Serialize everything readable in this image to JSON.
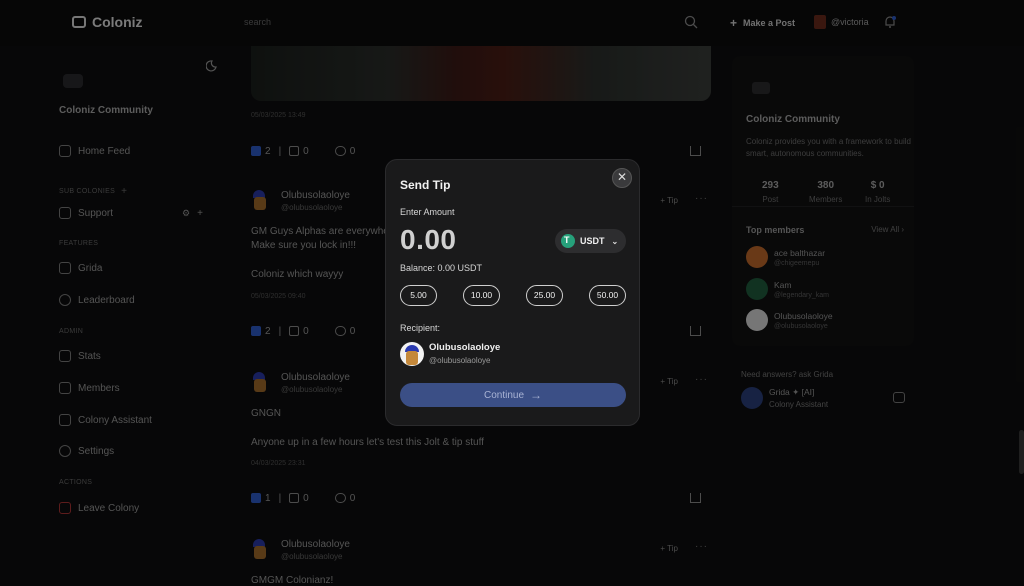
{
  "topbar": {
    "logo": "Coloniz",
    "search_placeholder": "search",
    "make_post": "Make a Post",
    "user": "@victoria"
  },
  "sidebar": {
    "community_name": "Coloniz Community",
    "home_feed": "Home Feed",
    "sub_colonies_label": "SUB COLONIES",
    "support": "Support",
    "features_label": "FEATURES",
    "grida": "Grida",
    "leaderboard": "Leaderboard",
    "admin_label": "ADMIN",
    "stats": "Stats",
    "members": "Members",
    "colony_assistant": "Colony Assistant",
    "settings": "Settings",
    "actions_label": "ACTIONS",
    "leave_colony": "Leave Colony"
  },
  "feed": {
    "posts": [
      {
        "time": "05/03/2025 13:49",
        "likes": "2",
        "dislikes": "0",
        "comments": "0"
      },
      {
        "name": "Olubusolaoloye",
        "handle": "@olubusolaoloye",
        "tip": "Tip",
        "text1": "GM Guys Alphas are everywhe",
        "text2": "Make sure you lock in!!!",
        "text3": "Coloniz which wayyy",
        "time": "05/03/2025 09:40",
        "likes": "2",
        "dislikes": "0",
        "comments": "0"
      },
      {
        "name": "Olubusolaoloye",
        "handle": "@olubusolaoloye",
        "tip": "Tip",
        "text1": "GNGN",
        "text2": "Anyone up in a few hours let's test this Jolt & tip stuff",
        "time": "04/03/2025 23:31",
        "likes": "1",
        "dislikes": "0",
        "comments": "0"
      },
      {
        "name": "Olubusolaoloye",
        "handle": "@olubusolaoloye",
        "tip": "Tip",
        "text1": "GMGM Colonianz!"
      }
    ]
  },
  "right_panel": {
    "community_name": "Coloniz Community",
    "description": "Coloniz provides you with a framework to build smart, autonomous communities.",
    "stats": [
      {
        "value": "293",
        "label": "Post"
      },
      {
        "value": "380",
        "label": "Members"
      },
      {
        "value": "$ 0",
        "label": "In Jolts"
      }
    ],
    "top_members_label": "Top members",
    "view_all": "View All",
    "members": [
      {
        "name": "ace balthazar",
        "handle": "@chigeemepu",
        "color": "#c0692a"
      },
      {
        "name": "Kam",
        "handle": "@legendary_kam",
        "color": "#1f5b3c"
      },
      {
        "name": "Olubusolaoloye",
        "handle": "@olubusolaoloye",
        "color": "#d8d8d8"
      }
    ],
    "need_answers": "Need answers? ask Grida",
    "grida_name": "Grida ✦ [AI]",
    "grida_sub": "Colony Assistant"
  },
  "modal": {
    "title": "Send Tip",
    "enter_amount": "Enter Amount",
    "amount": "0.00",
    "currency": "USDT",
    "balance": "Balance: 0.00 USDT",
    "presets": [
      "5.00",
      "10.00",
      "25.00",
      "50.00"
    ],
    "recipient_label": "Recipient:",
    "recipient_name": "Olubusolaoloye",
    "recipient_handle": "@olubusolaoloye",
    "continue": "Continue",
    "accent": "#3b4f86"
  }
}
